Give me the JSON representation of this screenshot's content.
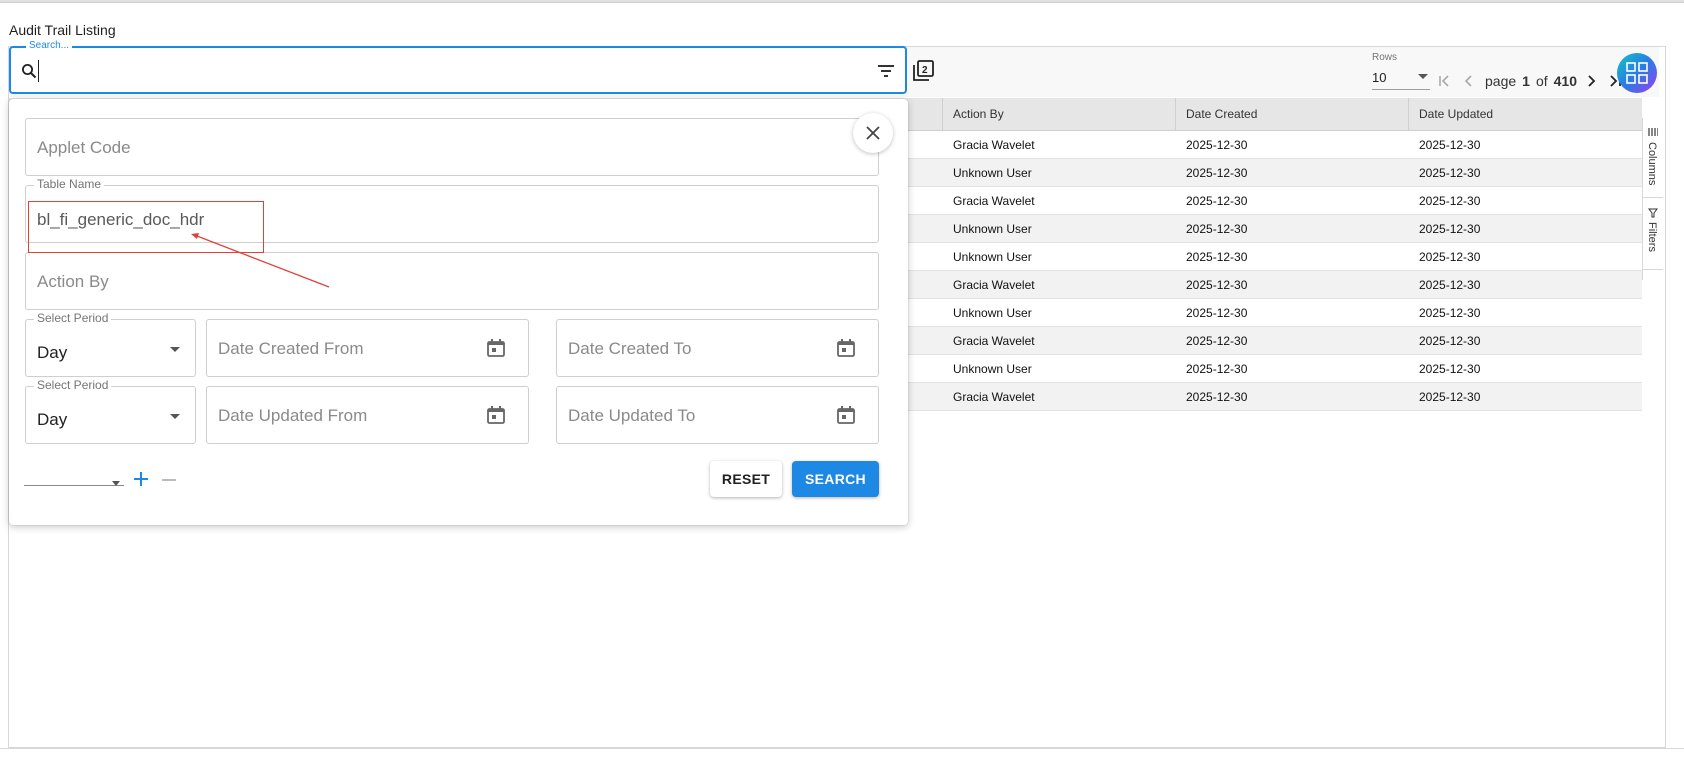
{
  "page": {
    "title": "Audit Trail Listing"
  },
  "search": {
    "legend": "Search...",
    "value": ""
  },
  "pager": {
    "rows_label": "Rows",
    "rows_value": "10",
    "page_word": "page",
    "current_page": "1",
    "of_word": "of",
    "total_pages": "410"
  },
  "table": {
    "headers": [
      "Action By",
      "Date Created",
      "Date Updated"
    ],
    "rows": [
      {
        "action_by": "Gracia Wavelet",
        "date_created": "2025-12-30",
        "date_updated": "2025-12-30"
      },
      {
        "action_by": "Unknown User",
        "date_created": "2025-12-30",
        "date_updated": "2025-12-30"
      },
      {
        "action_by": "Gracia Wavelet",
        "date_created": "2025-12-30",
        "date_updated": "2025-12-30"
      },
      {
        "action_by": "Unknown User",
        "date_created": "2025-12-30",
        "date_updated": "2025-12-30"
      },
      {
        "action_by": "Unknown User",
        "date_created": "2025-12-30",
        "date_updated": "2025-12-30"
      },
      {
        "action_by": "Gracia Wavelet",
        "date_created": "2025-12-30",
        "date_updated": "2025-12-30"
      },
      {
        "action_by": "Unknown User",
        "date_created": "2025-12-30",
        "date_updated": "2025-12-30"
      },
      {
        "action_by": "Gracia Wavelet",
        "date_created": "2025-12-30",
        "date_updated": "2025-12-30"
      },
      {
        "action_by": "Unknown User",
        "date_created": "2025-12-30",
        "date_updated": "2025-12-30"
      },
      {
        "action_by": "Gracia Wavelet",
        "date_created": "2025-12-30",
        "date_updated": "2025-12-30"
      }
    ]
  },
  "side_panel": {
    "columns_label": "Columns",
    "filters_label": "Filters"
  },
  "filter_popup": {
    "applet_code_placeholder": "Applet Code",
    "table_name_label": "Table Name",
    "table_name_value": "bl_fi_generic_doc_hdr",
    "action_by_placeholder": "Action By",
    "created_period": {
      "label": "Select Period",
      "value": "Day"
    },
    "date_created_from": "Date Created From",
    "date_created_to": "Date Created To",
    "updated_period": {
      "label": "Select Period",
      "value": "Day"
    },
    "date_updated_from": "Date Updated From",
    "date_updated_to": "Date Updated To",
    "reset_label": "RESET",
    "search_label": "SEARCH"
  },
  "colors": {
    "accent": "#1e88e5",
    "annotation": "#e0423b",
    "header_bg": "#e6e6e6"
  },
  "icons": [
    "search-icon",
    "filter-lines-icon",
    "copy-icon",
    "first-page-icon",
    "prev-page-icon",
    "next-page-icon",
    "last-page-icon",
    "apps-grid-icon",
    "close-icon",
    "calendar-icon",
    "plus-icon",
    "minus-icon",
    "columns-icon",
    "filter-icon"
  ]
}
